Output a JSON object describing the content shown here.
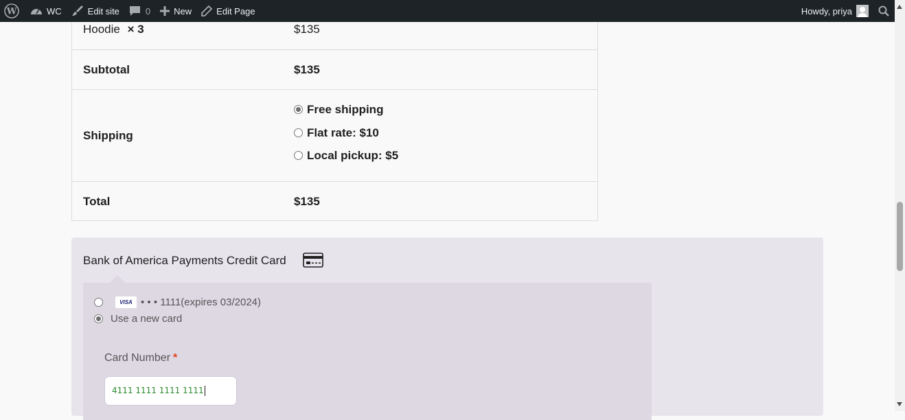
{
  "adminbar": {
    "site_name": "WC",
    "edit_site": "Edit site",
    "comments_count": "0",
    "new_label": "New",
    "edit_page": "Edit Page",
    "howdy": "Howdy, priya"
  },
  "order": {
    "item_name": "Hoodie",
    "item_qty": "× 3",
    "item_total": "$135",
    "subtotal_label": "Subtotal",
    "subtotal_value": "$135",
    "shipping_label": "Shipping",
    "shipping_options": [
      {
        "label": "Free shipping",
        "selected": true
      },
      {
        "label": "Flat rate: $10",
        "selected": false
      },
      {
        "label": "Local pickup: $5",
        "selected": false
      }
    ],
    "total_label": "Total",
    "total_value": "$135"
  },
  "payment": {
    "method_title": "Bank of America Payments Credit Card",
    "saved_card_brand": "VISA",
    "saved_card_text": "• • • 1111(expires 03/2024)",
    "new_card_label": "Use a new card",
    "card_number_label": "Card Number",
    "required_mark": "*",
    "card_number_value": "4111 1111 1111 1111"
  },
  "colors": {
    "adminbar_bg": "#1d2327",
    "payment_bg": "#e8e4ec",
    "payment_inner_bg": "#ded8e3",
    "required": "#e2401c",
    "card_number_text": "#2a8a2a"
  }
}
